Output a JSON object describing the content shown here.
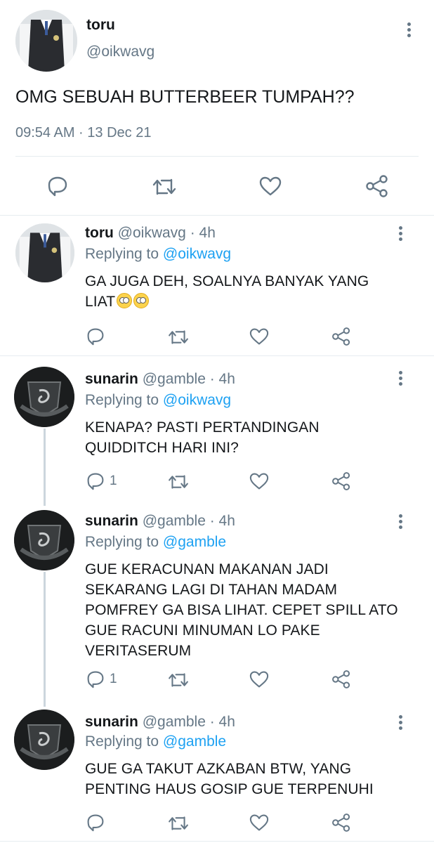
{
  "main_tweet": {
    "name": "toru",
    "handle": "@oikwavg",
    "text": "OMG SEBUAH BUTTERBEER TUMPAH??",
    "timestamp": "09:54 AM · 13 Dec 21"
  },
  "replies": [
    {
      "name": "toru",
      "handle_time": "@oikwavg · 4h",
      "replying_prefix": "Replying to ",
      "replying_to": "@oikwavg",
      "text": "GA JUGA DEH, SOALNYA BANYAK YANG LIAT",
      "emoji": [
        "face-with-rolling-eyes",
        "face-with-rolling-eyes"
      ],
      "reply_count": ""
    },
    {
      "name": "sunarin",
      "handle_time": "@gamble · 4h",
      "replying_prefix": "Replying to ",
      "replying_to": "@oikwavg",
      "text": "KENAPA? PASTI PERTANDINGAN QUIDDITCH HARI INI?",
      "reply_count": "1"
    },
    {
      "name": "sunarin",
      "handle_time": "@gamble · 4h",
      "replying_prefix": "Replying to ",
      "replying_to": "@gamble",
      "text": "GUE KERACUNAN MAKANAN JADI SEKARANG LAGI DI TAHAN MADAM POMFREY GA BISA LIHAT. CEPET SPILL ATO GUE RACUNI MINUMAN LO PAKE VERITASERUM",
      "reply_count": "1"
    },
    {
      "name": "sunarin",
      "handle_time": "@gamble · 4h",
      "replying_prefix": "Replying to ",
      "replying_to": "@gamble",
      "text": "GUE GA TAKUT AZKABAN BTW, YANG PENTING HAUS GOSIP GUE TERPENUHI",
      "reply_count": ""
    }
  ],
  "icons": {
    "reply": "reply-icon",
    "retweet": "retweet-icon",
    "like": "like-icon",
    "share": "share-icon",
    "more": "more-options-icon"
  },
  "colors": {
    "accent": "#1da1f2",
    "secondary_text": "#657786",
    "divider": "#e6ecf0",
    "thread_line": "#ccd6dd"
  }
}
